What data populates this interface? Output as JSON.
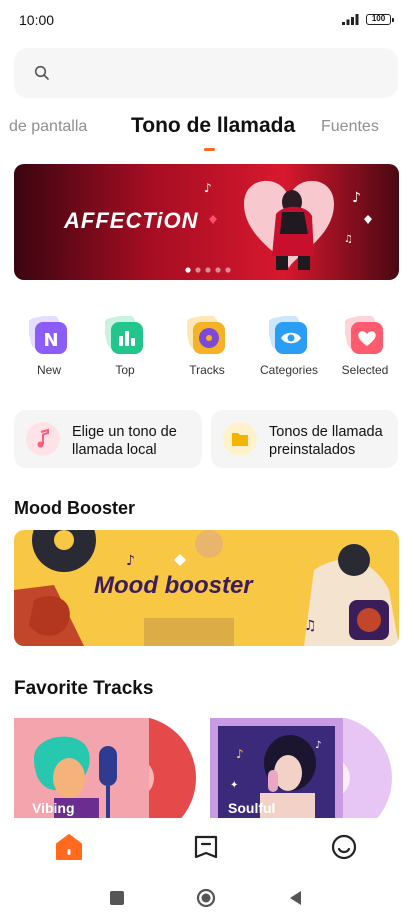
{
  "status_bar": {
    "time": "10:00",
    "battery": "100"
  },
  "search": {
    "placeholder": ""
  },
  "tabs": [
    {
      "label": "de pantalla"
    },
    {
      "label": "Tono de llamada"
    },
    {
      "label": "Fuentes"
    }
  ],
  "banner": {
    "title": "AFFECTiON",
    "carousel_dots": 5,
    "active_dot": 1
  },
  "categories": [
    {
      "label": "New",
      "icon": "new-icon",
      "color": "#8b5cf6"
    },
    {
      "label": "Top",
      "icon": "chart-icon",
      "color": "#22c58b"
    },
    {
      "label": "Tracks",
      "icon": "turntable-icon",
      "color": "#f5b227"
    },
    {
      "label": "Categories",
      "icon": "eye-icon",
      "color": "#2a9df4"
    },
    {
      "label": "Selected",
      "icon": "heart-icon",
      "color": "#ff5b6e"
    }
  ],
  "quick_actions": [
    {
      "label": "Elige un tono de llamada local",
      "icon": "music-note-icon"
    },
    {
      "label": "Tonos de llamada preinstalados",
      "icon": "folder-icon"
    }
  ],
  "mood_section": {
    "title": "Mood Booster",
    "banner_text": "Mood booster"
  },
  "favorites_section": {
    "title": "Favorite Tracks",
    "tracks": [
      {
        "label": "Vibing"
      },
      {
        "label": "Soulful"
      }
    ]
  },
  "bottom_nav": [
    {
      "name": "home",
      "icon": "home-icon",
      "active": true
    },
    {
      "name": "saved",
      "icon": "bookmark-icon",
      "active": false
    },
    {
      "name": "profile",
      "icon": "smiley-icon",
      "active": false
    }
  ],
  "colors": {
    "accent": "#ff6a1f",
    "banner_bg": "#c8102e",
    "mood_bg": "#f8c744"
  }
}
